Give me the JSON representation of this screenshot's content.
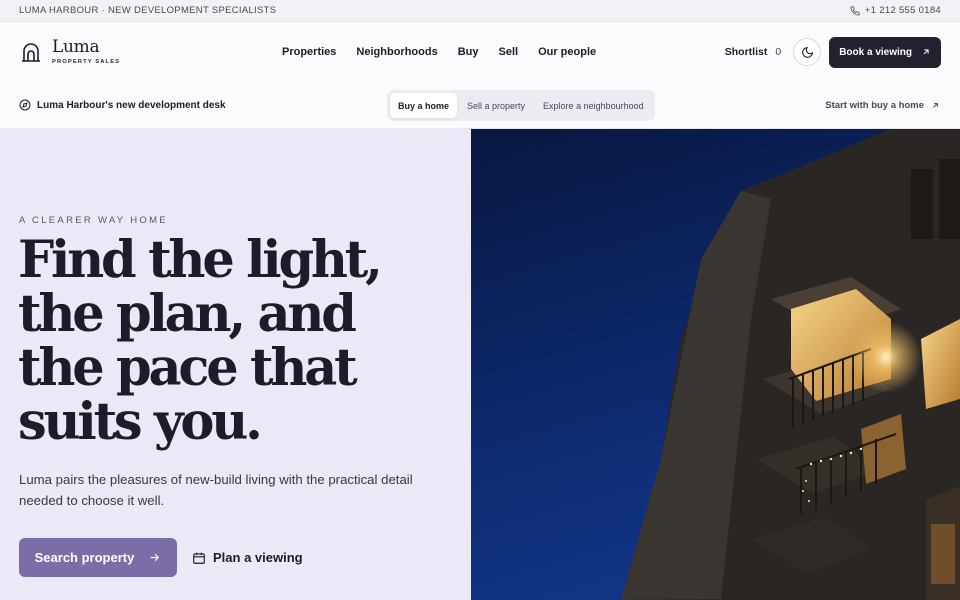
{
  "topbar": {
    "tagline": "LUMA HARBOUR · NEW DEVELOPMENT SPECIALISTS",
    "phone": "+1 212 555 0184"
  },
  "brand": {
    "name": "Luma",
    "sub": "PROPERTY SALES"
  },
  "nav": {
    "items": [
      "Properties",
      "Neighborhoods",
      "Buy",
      "Sell",
      "Our people"
    ]
  },
  "actions": {
    "shortlist_label": "Shortlist",
    "shortlist_count": "0",
    "book_label": "Book a viewing"
  },
  "subbar": {
    "desk_label": "Luma Harbour's new development desk",
    "segments": [
      "Buy a home",
      "Sell a property",
      "Explore a neighbourhood"
    ],
    "active_segment": "Buy a home",
    "start_link": "Start with buy a home"
  },
  "hero": {
    "eyebrow": "A CLEARER WAY HOME",
    "headline_lines": [
      "Find the light,",
      "the plan, and",
      "the pace that",
      "suits you."
    ],
    "lede": "Luma pairs the pleasures of new-build living with the practical detail needed to choose it well.",
    "cta_primary": "Search property",
    "cta_secondary": "Plan a viewing"
  },
  "colors": {
    "accent": "#7b6ea8",
    "hero_bg": "#ece8f5",
    "dark_button": "#24212e",
    "sky": "#0c1f4f"
  },
  "icons": {
    "phone": "phone-icon",
    "theme": "moon-icon",
    "compass": "compass-icon",
    "arrow": "arrow-up-right-icon",
    "calendar": "calendar-icon"
  }
}
